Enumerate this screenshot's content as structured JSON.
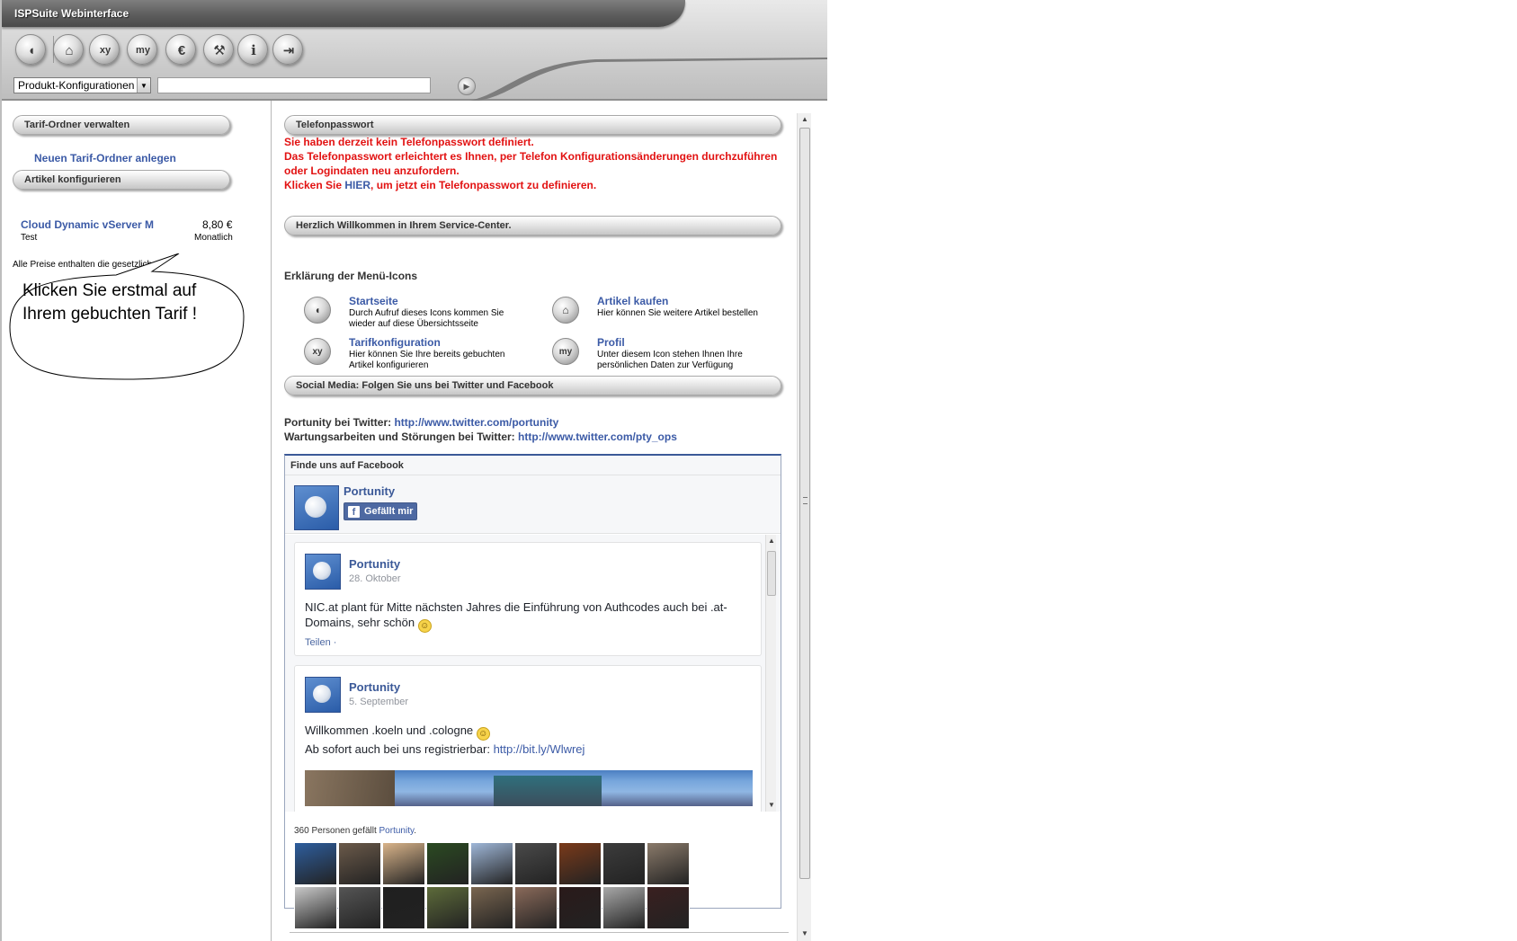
{
  "app": {
    "title": "ISPSuite Webinterface"
  },
  "toolbar": {
    "buttons": [
      {
        "name": "home-icon",
        "glyph": "◖"
      },
      {
        "name": "cart-icon",
        "glyph": "⌂"
      },
      {
        "name": "xy-config-icon",
        "glyph": "xy"
      },
      {
        "name": "my-profile-icon",
        "glyph": "my"
      },
      {
        "name": "invoice-icon",
        "glyph": "€"
      },
      {
        "name": "tools-icon",
        "glyph": "⚒"
      },
      {
        "name": "info-icon",
        "glyph": "i"
      },
      {
        "name": "logout-icon",
        "glyph": "⇥"
      }
    ]
  },
  "search": {
    "select_value": "Produkt-Konfigurationen",
    "input_value": "",
    "go_glyph": "▶"
  },
  "sidebar": {
    "folders_header": "Tarif-Ordner verwalten",
    "new_folder_link": "Neuen Tarif-Ordner anlegen",
    "articles_header": "Artikel konfigurieren",
    "item": {
      "name": "Cloud Dynamic vServer M",
      "sub": "Test",
      "price": "8,80 €",
      "period": "Monatlich"
    },
    "price_note": "Alle Preise enthalten die gesetzliche",
    "callout": "Klicken Sie erstmal auf Ihrem gebuchten Tarif !"
  },
  "main": {
    "phone_header": "Telefonpasswort",
    "phone_line1": "Sie haben derzeit kein Telefonpasswort definiert.",
    "phone_line2": "Das Telefonpasswort erleichtert es Ihnen, per Telefon Konfigurationsänderungen durchzuführen oder Logindaten neu anzufordern.",
    "phone_line3_a": "Klicken Sie ",
    "phone_line3_link": "HIER",
    "phone_line3_b": ", um jetzt ein Telefonpasswort zu definieren.",
    "welcome_header": "Herzlich Willkommen in Ihrem Service-Center.",
    "menu_title": "Erklärung der Menü-Icons",
    "menu_items": [
      {
        "title": "Startseite",
        "desc": "Durch Aufruf dieses Icons kommen Sie wieder auf diese Übersichtsseite",
        "glyph": "◖"
      },
      {
        "title": "Artikel kaufen",
        "desc": "Hier können Sie weitere Artikel bestellen",
        "glyph": "⌂"
      },
      {
        "title": "Tarifkonfiguration",
        "desc": "Hier können Sie Ihre bereits gebuchten Artikel konfigurieren",
        "glyph": "xy"
      },
      {
        "title": "Profil",
        "desc": "Unter diesem Icon stehen Ihnen Ihre persönlichen Daten zur Verfügung",
        "glyph": "my"
      }
    ],
    "social_header": "Social Media: Folgen Sie uns bei Twitter und Facebook",
    "twitter_label": "Portunity bei Twitter: ",
    "twitter_url": "http://www.twitter.com/portunity",
    "ops_label": "Wartungsarbeiten und Störungen bei Twitter: ",
    "ops_url": "http://www.twitter.com/pty_ops"
  },
  "facebook": {
    "box_title": "Finde uns auf Facebook",
    "page_name": "Portunity",
    "like_label": "Gefällt mir",
    "posts": [
      {
        "author": "Portunity",
        "date": "28. Oktober",
        "text": "NIC.at plant für Mitte nächsten Jahres die Einführung von Authcodes auch bei .at-Domains, sehr schön",
        "share": "Teilen ·"
      },
      {
        "author": "Portunity",
        "date": "5. September",
        "text": "Willkommen .koeln und .cologne",
        "text2": "Ab sofort auch bei uns registrierbar: ",
        "link": "http://bit.ly/Wlwrej"
      }
    ],
    "fans_text_a": "360 Personen gefällt ",
    "fans_text_link": "Portunity",
    "fans_text_b": ".",
    "fan_colors": [
      "#2e5e9e",
      "#6b5a4a",
      "#d9b48a",
      "#2b4a22",
      "#9fb7d8",
      "#4a4a4a",
      "#7a3a1a",
      "#3c3c3c",
      "#8a7a6a",
      "#c9c9c9",
      "#555555",
      "#1f1f1f",
      "#5d6b3a",
      "#7a6650",
      "#8a6a5a",
      "#2a1a1a",
      "#a8a8a8",
      "#3a2020"
    ]
  },
  "colors": {
    "link": "#3b5aa6",
    "alert": "#e21212",
    "facebook": "#3b5998"
  }
}
